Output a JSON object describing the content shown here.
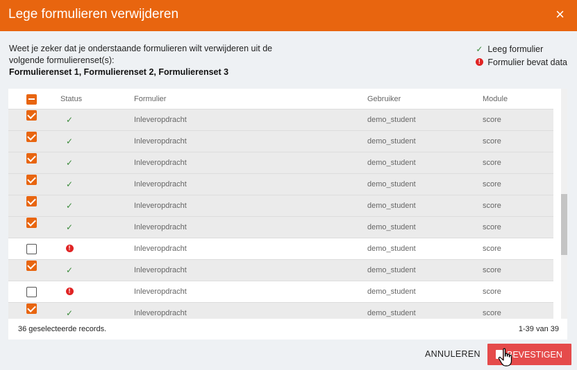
{
  "dialog": {
    "title": "Lege formulieren verwijderen",
    "close_icon": "×",
    "intro_text": "Weet je zeker dat je onderstaande formulieren wilt verwijderen uit de volgende formulierenset(s):",
    "sets_text": "Formulierenset 1, Formulierenset 2, Formulierenset 3"
  },
  "legend": {
    "empty_label": "Leeg formulier",
    "data_label": "Formulier bevat data"
  },
  "icons": {
    "check": "✓",
    "error": "!"
  },
  "table": {
    "headers": {
      "status": "Status",
      "form": "Formulier",
      "user": "Gebruiker",
      "module": "Module"
    },
    "rows": [
      {
        "checked": true,
        "status": "empty",
        "form": "Inleveropdracht",
        "user": "demo_student",
        "module": "score"
      },
      {
        "checked": true,
        "status": "empty",
        "form": "Inleveropdracht",
        "user": "demo_student",
        "module": "score"
      },
      {
        "checked": true,
        "status": "empty",
        "form": "Inleveropdracht",
        "user": "demo_student",
        "module": "score"
      },
      {
        "checked": true,
        "status": "empty",
        "form": "Inleveropdracht",
        "user": "demo_student",
        "module": "score"
      },
      {
        "checked": true,
        "status": "empty",
        "form": "Inleveropdracht",
        "user": "demo_student",
        "module": "score"
      },
      {
        "checked": true,
        "status": "empty",
        "form": "Inleveropdracht",
        "user": "demo_student",
        "module": "score"
      },
      {
        "checked": false,
        "status": "data",
        "form": "Inleveropdracht",
        "user": "demo_student",
        "module": "score"
      },
      {
        "checked": true,
        "status": "empty",
        "form": "Inleveropdracht",
        "user": "demo_student",
        "module": "score"
      },
      {
        "checked": false,
        "status": "data",
        "form": "Inleveropdracht",
        "user": "demo_student",
        "module": "score"
      },
      {
        "checked": true,
        "status": "empty",
        "form": "Inleveropdracht",
        "user": "demo_student",
        "module": "score"
      }
    ],
    "selected_count_text": "36 geselecteerde records.",
    "range_text": "1-39 van 39"
  },
  "buttons": {
    "cancel_label": "ANNULEREN",
    "confirm_label": "BEVESTIGEN"
  },
  "colors": {
    "accent": "#e8650f",
    "confirm": "#e54b4b",
    "error": "#e02424",
    "check": "#3a8a3a"
  }
}
